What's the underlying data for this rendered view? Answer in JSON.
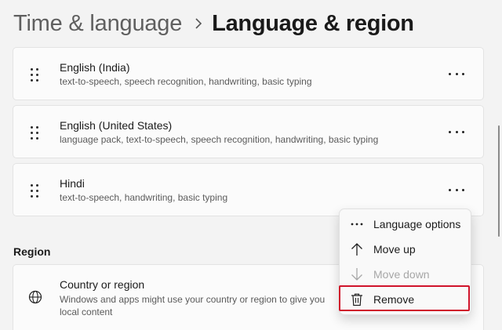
{
  "header": {
    "parent": "Time & language",
    "current": "Language & region"
  },
  "languages": [
    {
      "name": "English (India)",
      "features": "text-to-speech, speech recognition, handwriting, basic typing"
    },
    {
      "name": "English (United States)",
      "features": "language pack, text-to-speech, speech recognition, handwriting, basic typing"
    },
    {
      "name": "Hindi",
      "features": "text-to-speech, handwriting, basic typing"
    }
  ],
  "region": {
    "section_label": "Region",
    "title": "Country or region",
    "description": "Windows and apps might use your country or region to give you local content"
  },
  "context_menu": {
    "items": [
      {
        "label": "Language options",
        "icon": "more-horizontal-icon",
        "enabled": true
      },
      {
        "label": "Move up",
        "icon": "arrow-up-icon",
        "enabled": true
      },
      {
        "label": "Move down",
        "icon": "arrow-down-icon",
        "enabled": false
      },
      {
        "label": "Remove",
        "icon": "trash-icon",
        "enabled": true,
        "highlighted": true
      }
    ]
  },
  "colors": {
    "background": "#f3f3f3",
    "card": "#fbfbfb",
    "highlight": "#d0142b",
    "disabled_text": "#a7a7a7"
  }
}
